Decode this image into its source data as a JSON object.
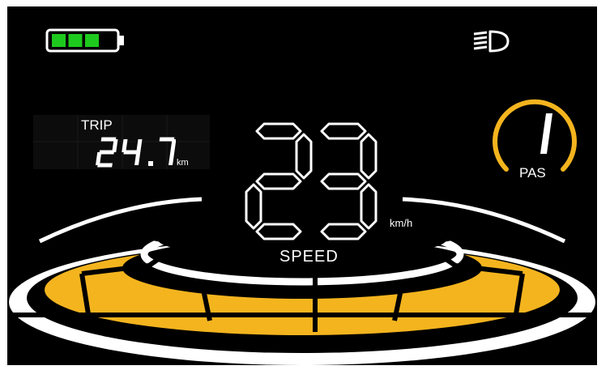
{
  "status": {
    "battery_level": 0.75,
    "battery_color": "#1ec91e",
    "headlight_icon": "headlight-low-beam-icon"
  },
  "trip": {
    "label": "TRIP",
    "value": "24.7",
    "unit": "km"
  },
  "pas": {
    "label": "PAS",
    "level": "1",
    "ring_color": "#f4b41e"
  },
  "speed": {
    "value": "23",
    "unit": "km/h",
    "label": "SPEED"
  },
  "gauge": {
    "accent_color": "#f4b41e",
    "lit_segments": 8
  }
}
